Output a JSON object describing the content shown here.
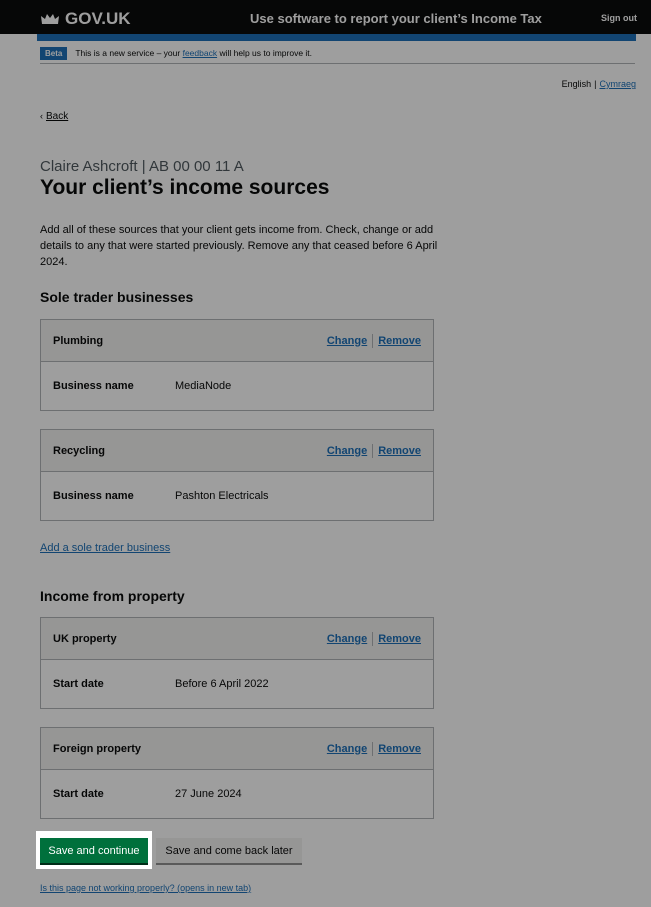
{
  "header": {
    "logo_text": "GOV.UK",
    "service_name": "Use software to report your client’s Income Tax",
    "sign_out": "Sign out"
  },
  "phase_banner": {
    "tag": "Beta",
    "text_before": "This is a new service – your ",
    "feedback_link": "feedback",
    "text_after": " will help us to improve it."
  },
  "language": {
    "english": "English",
    "welsh": "Cymraeg"
  },
  "back_link": "Back",
  "caption": "Claire Ashcroft | AB 00 00 11 A",
  "heading": "Your client’s income sources",
  "intro": "Add all of these sources that your client gets income from. Check, change or add details to any that were started previously. Remove any that ceased before 6 April 2024.",
  "sole_trader": {
    "heading": "Sole trader businesses",
    "cards": [
      {
        "title": "Plumbing",
        "change": "Change",
        "remove": "Remove",
        "key": "Business name",
        "value": "MediaNode"
      },
      {
        "title": "Recycling",
        "change": "Change",
        "remove": "Remove",
        "key": "Business name",
        "value": "Pashton Electricals"
      }
    ],
    "add_link": "Add a sole trader business"
  },
  "property": {
    "heading": "Income from property",
    "cards": [
      {
        "title": "UK property",
        "change": "Change",
        "remove": "Remove",
        "key": "Start date",
        "value": "Before 6 April 2022"
      },
      {
        "title": "Foreign property",
        "change": "Change",
        "remove": "Remove",
        "key": "Start date",
        "value": "27 June 2024"
      }
    ]
  },
  "buttons": {
    "save_continue": "Save and continue",
    "save_later": "Save and come back later"
  },
  "report_link": "Is this page not working properly? (opens in new tab)",
  "colors": {
    "header_bg": "#0b0c0c",
    "brand_blue": "#1d70b8",
    "button_green": "#00703c",
    "focus_yellow": "#ffdd00"
  }
}
